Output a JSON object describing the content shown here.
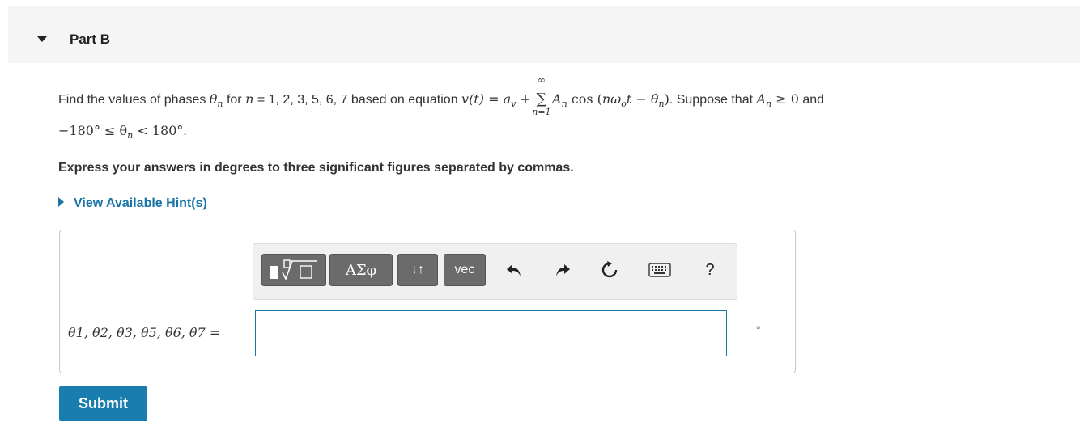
{
  "part": {
    "title": "Part B"
  },
  "question": {
    "intro": "Find the values of phases ",
    "theta_n": "θ",
    "n_sub": "n",
    "for_text": " for ",
    "n_var": "n",
    "n_values": " = 1, 2, 3, 5, 6, 7 based on equation ",
    "eq_lhs": "v(t) = a",
    "eq_av_sub": "v",
    "eq_plus": " + ",
    "sum_symbol": "∑",
    "sum_upper": "∞",
    "sum_lower": "n=1",
    "eq_An": "A",
    "eq_An_sub": "n",
    "eq_cos": " cos (",
    "eq_inner": "nω",
    "eq_omega_sub": "o",
    "eq_t_minus": "t − θ",
    "eq_theta_sub": "n",
    "eq_close": ")",
    "suppose": ". Suppose that ",
    "cond_A": "A",
    "cond_A_sub": "n",
    "cond_ge": " ≥ 0",
    "and_text": " and",
    "range_left": "−180° ≤ θ",
    "range_sub": "n",
    "range_right": " < 180°",
    "range_end": "."
  },
  "instructions": "Express your answers in degrees to three significant figures separated by commas.",
  "hint": {
    "label": "View Available Hint(s)"
  },
  "toolbar": {
    "templates_icon": "radical-template-icon",
    "greek_label": "ΑΣφ",
    "arrows_label": "↓↑",
    "vec_label": "vec",
    "undo_icon": "undo-icon",
    "redo_icon": "redo-icon",
    "reset_icon": "reset-icon",
    "keyboard_icon": "keyboard-icon",
    "help_label": "?"
  },
  "answer": {
    "label": "θ1, θ2, θ3, θ5, θ6, θ7 =",
    "value": "",
    "unit": "°"
  },
  "submit": {
    "label": "Submit"
  },
  "colors": {
    "link": "#1a75a7",
    "submit_bg": "#1a7db0",
    "toolbar_button": "#6b6b6b"
  }
}
